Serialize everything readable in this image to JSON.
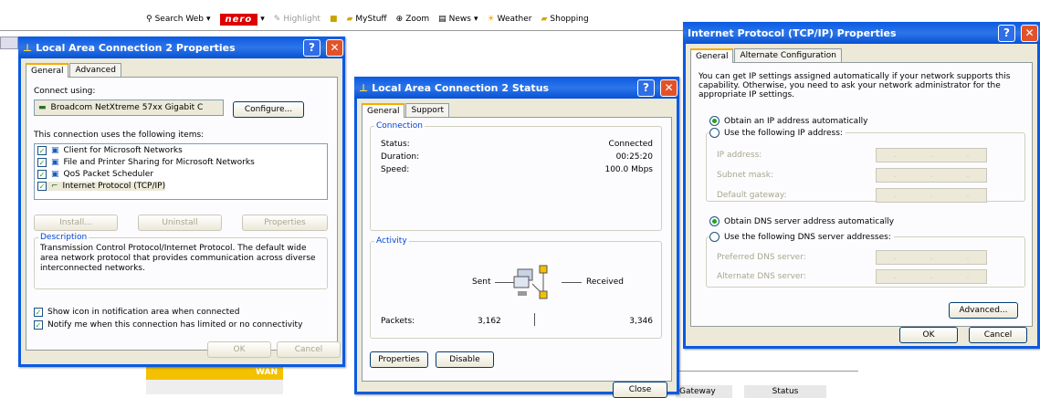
{
  "toolbar": {
    "search_web": "Search Web",
    "nero": "nero",
    "highlight": "Highlight",
    "mystuff": "MyStuff",
    "zoom": "Zoom",
    "news": "News",
    "weather": "Weather",
    "shopping": "Shopping"
  },
  "background": {
    "wan": "WAN",
    "gateway": "Gateway",
    "status": "Status"
  },
  "lac_props": {
    "title": "Local Area Connection 2 Properties",
    "tabs": [
      "General",
      "Advanced"
    ],
    "connect_using": "Connect using:",
    "adapter": "Broadcom NetXtreme 57xx Gigabit C",
    "configure": "Configure...",
    "items_label": "This connection uses the following items:",
    "items": [
      {
        "label": "Client for Microsoft Networks",
        "checked": true
      },
      {
        "label": "File and Printer Sharing for Microsoft Networks",
        "checked": true
      },
      {
        "label": "QoS Packet Scheduler",
        "checked": true
      },
      {
        "label": "Internet Protocol (TCP/IP)",
        "checked": true
      }
    ],
    "install": "Install...",
    "uninstall": "Uninstall",
    "properties": "Properties",
    "description_legend": "Description",
    "description": "Transmission Control Protocol/Internet Protocol. The default wide area network protocol that provides communication across diverse interconnected networks.",
    "show_icon": "Show icon in notification area when connected",
    "notify": "Notify me when this connection has limited or no connectivity",
    "ok": "OK",
    "cancel": "Cancel"
  },
  "lac_status": {
    "title": "Local Area Connection 2 Status",
    "tabs": [
      "General",
      "Support"
    ],
    "connection_legend": "Connection",
    "status_label": "Status:",
    "status_value": "Connected",
    "duration_label": "Duration:",
    "duration_value": "00:25:20",
    "speed_label": "Speed:",
    "speed_value": "100.0 Mbps",
    "activity_legend": "Activity",
    "sent": "Sent",
    "received": "Received",
    "packets_label": "Packets:",
    "packets_sent": "3,162",
    "packets_received": "3,346",
    "properties": "Properties",
    "disable": "Disable",
    "close": "Close"
  },
  "tcpip": {
    "title": "Internet Protocol (TCP/IP) Properties",
    "tabs": [
      "General",
      "Alternate Configuration"
    ],
    "intro": "You can get IP settings assigned automatically if your network supports this capability. Otherwise, you need to ask your network administrator for the appropriate IP settings.",
    "obtain_ip": "Obtain an IP address automatically",
    "use_ip": "Use the following IP address:",
    "ip_address": "IP address:",
    "subnet": "Subnet mask:",
    "gateway": "Default gateway:",
    "obtain_dns": "Obtain DNS server address automatically",
    "use_dns": "Use the following DNS server addresses:",
    "preferred_dns": "Preferred DNS server:",
    "alternate_dns": "Alternate DNS server:",
    "advanced": "Advanced...",
    "ok": "OK",
    "cancel": "Cancel"
  }
}
